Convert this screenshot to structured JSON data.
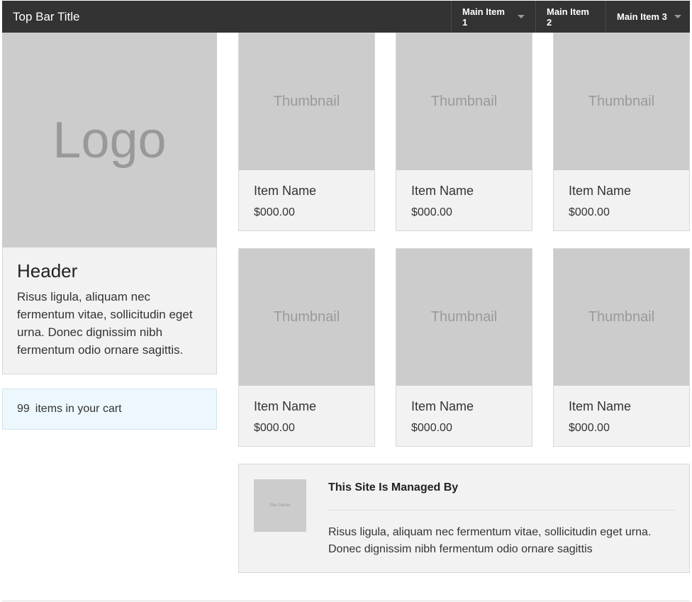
{
  "topbar": {
    "title": "Top Bar Title",
    "nav": [
      {
        "label": "Main Item 1",
        "dropdown": true
      },
      {
        "label": "Main Item 2",
        "dropdown": false
      },
      {
        "label": "Main Item 3",
        "dropdown": true
      }
    ]
  },
  "logo": {
    "text": "Logo"
  },
  "header_panel": {
    "title": "Header",
    "body": "Risus ligula, aliquam nec fermentum vitae, sollicitudin eget urna. Donec dignissim nibh fermentum odio ornare sagittis."
  },
  "cart": {
    "count": "99",
    "label": "items in your cart"
  },
  "products": [
    {
      "thumb": "Thumbnail",
      "name": "Item Name",
      "price": "$000.00"
    },
    {
      "thumb": "Thumbnail",
      "name": "Item Name",
      "price": "$000.00"
    },
    {
      "thumb": "Thumbnail",
      "name": "Item Name",
      "price": "$000.00"
    },
    {
      "thumb": "Thumbnail",
      "name": "Item Name",
      "price": "$000.00"
    },
    {
      "thumb": "Thumbnail",
      "name": "Item Name",
      "price": "$000.00"
    },
    {
      "thumb": "Thumbnail",
      "name": "Item Name",
      "price": "$000.00"
    }
  ],
  "managed": {
    "owner_image_text": "Site Owner",
    "title": "This Site Is Managed By",
    "body": "Risus ligula, aliquam nec fermentum vitae, sollicitudin eget urna. Donec dignissim nibh fermentum odio ornare sagittis"
  },
  "colors": {
    "topbar": "#333333",
    "placeholder": "#cccccc",
    "panel": "#f2f2f2",
    "cart_bg": "#ecf8fd"
  }
}
